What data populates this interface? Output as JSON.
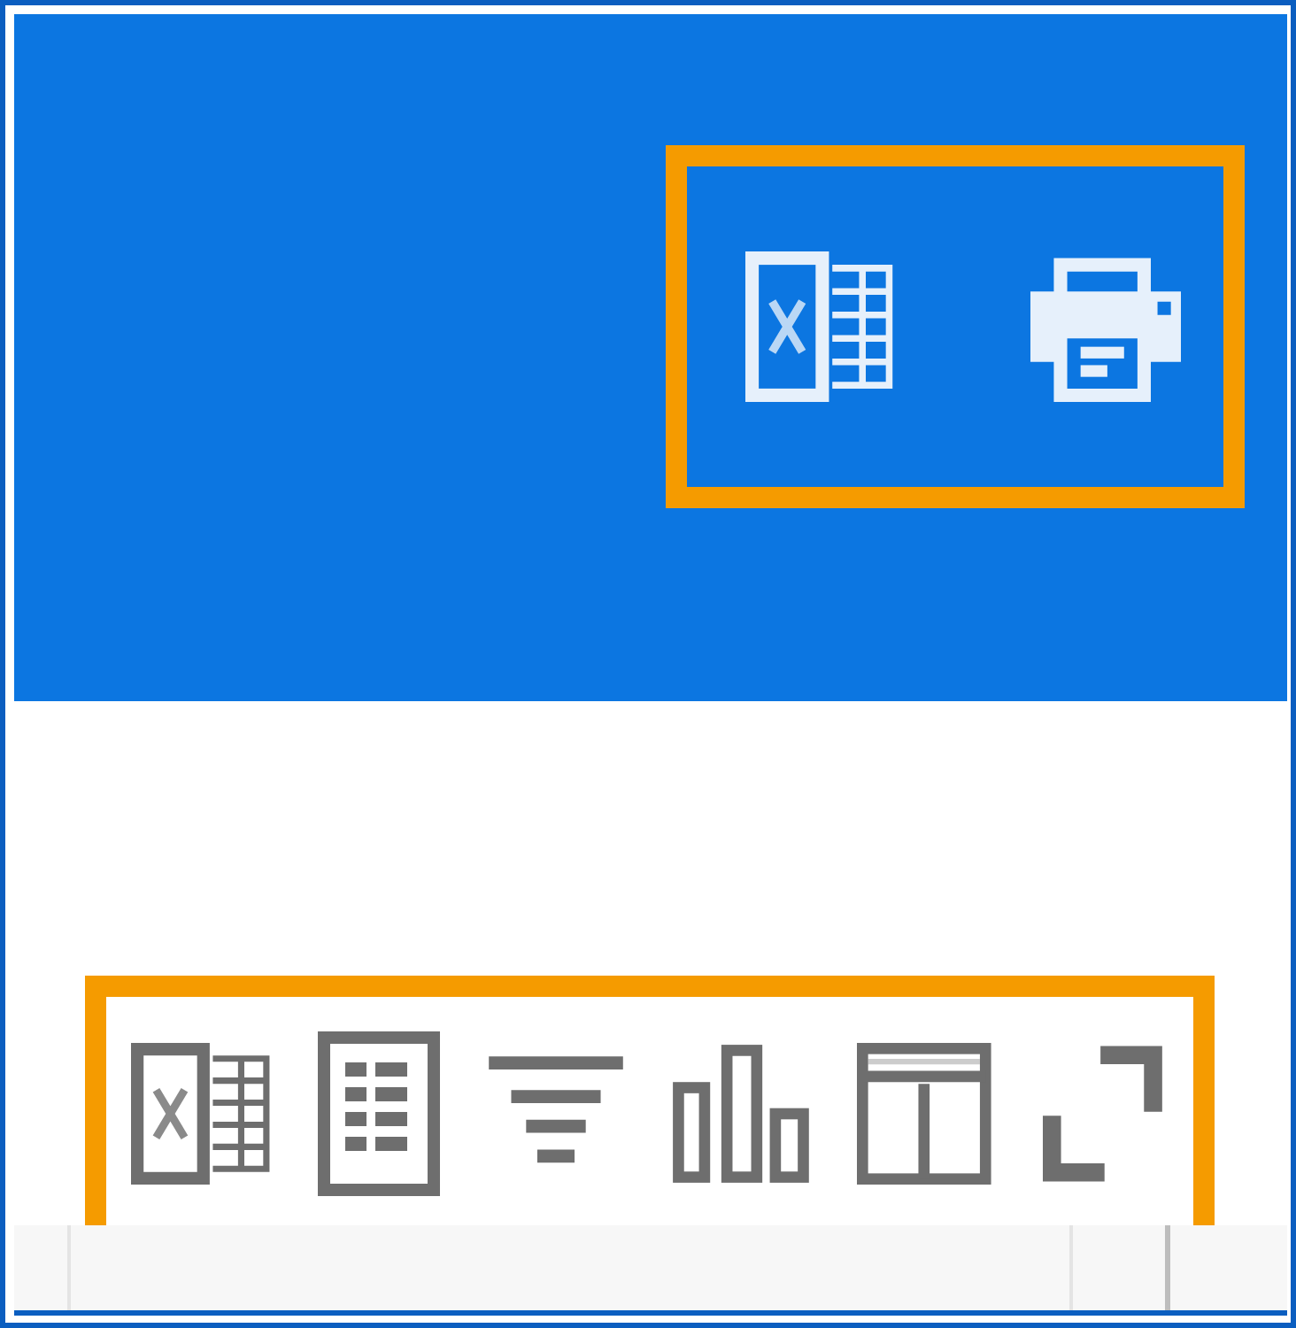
{
  "header_toolbar": {
    "highlighted": true,
    "icons": [
      {
        "kind": "spreadsheet"
      },
      {
        "kind": "printer"
      }
    ]
  },
  "visual_toolbar": {
    "highlighted": true,
    "icons": [
      {
        "kind": "spreadsheet"
      },
      {
        "kind": "table"
      },
      {
        "kind": "filter"
      },
      {
        "kind": "bar_chart"
      },
      {
        "kind": "layout"
      },
      {
        "kind": "expand"
      }
    ]
  }
}
